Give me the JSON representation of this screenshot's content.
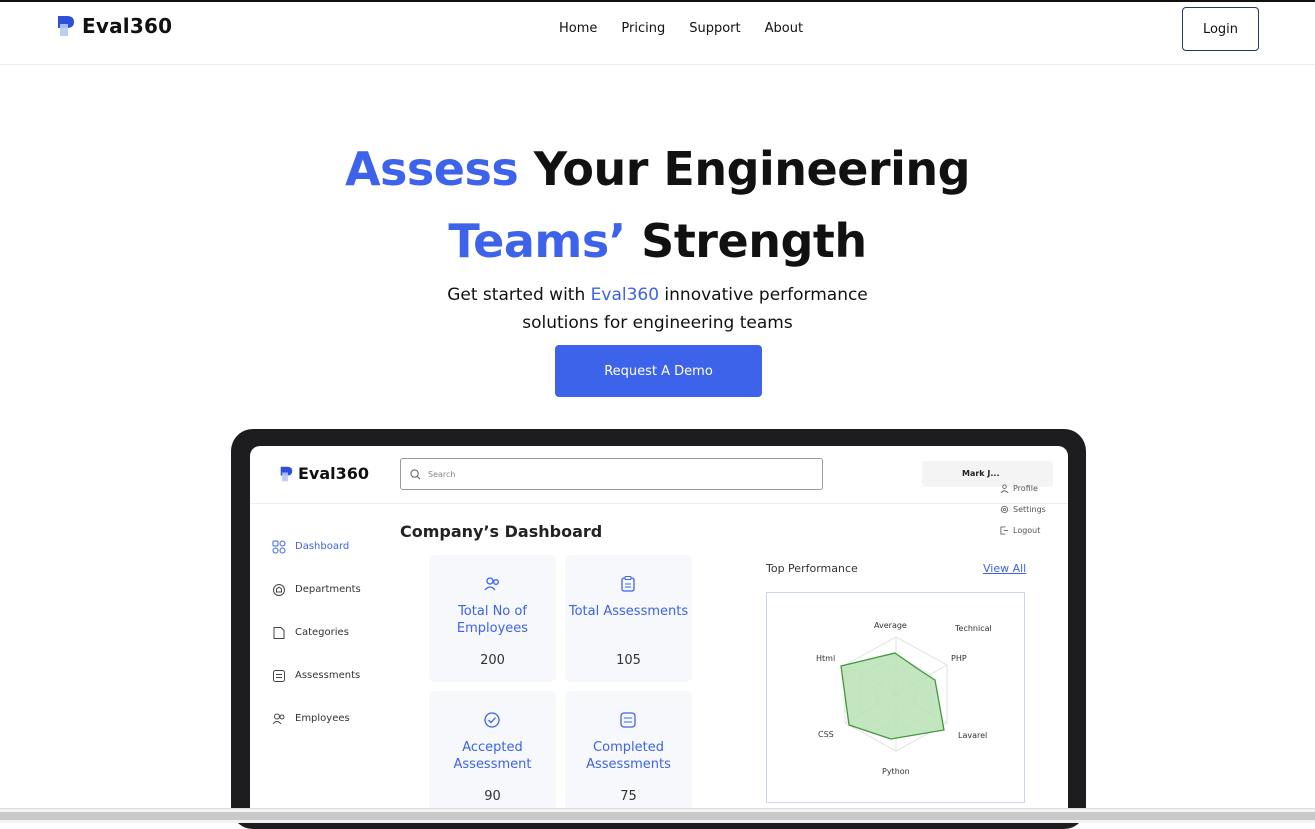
{
  "nav": {
    "brand": "Eval360",
    "links": [
      "Home",
      "Pricing",
      "Support",
      "About"
    ],
    "login": "Login"
  },
  "hero": {
    "line1_hl": "Assess",
    "line1_rest": " Your Engineering",
    "line2_hl": "Teams’",
    "line2_rest": " Strength",
    "sub_pre": "Get started with ",
    "sub_hl": "Eval360",
    "sub_post": " innovative performance",
    "sub_line2": "solutions for engineering teams",
    "cta": "Request A Demo"
  },
  "dashboard": {
    "brand": "Eval360",
    "search_placeholder": "Search",
    "user_name": "Mark J...",
    "user_menu": [
      "Profile",
      "Settings",
      "Logout"
    ],
    "sidebar": [
      {
        "label": "Dashboard",
        "icon": "grid-icon",
        "active": true
      },
      {
        "label": "Departments",
        "icon": "building-icon",
        "active": false
      },
      {
        "label": "Categories",
        "icon": "folder-icon",
        "active": false
      },
      {
        "label": "Assessments",
        "icon": "list-icon",
        "active": false
      },
      {
        "label": "Employees",
        "icon": "users-icon",
        "active": false
      }
    ],
    "title": "Company’s Dashboard",
    "stats": [
      {
        "label": "Total No of Employees",
        "value": "200",
        "icon": "users-icon"
      },
      {
        "label": "Total Assessments",
        "value": "105",
        "icon": "clipboard-icon"
      },
      {
        "label": "Accepted Assessment",
        "value": "90",
        "icon": "check-circle-icon"
      },
      {
        "label": "Completed Assessments",
        "value": "75",
        "icon": "list-check-icon"
      }
    ],
    "performance": {
      "title": "Top Performance",
      "view_all": "View All",
      "radar_labels": [
        "Average",
        "Technical",
        "PHP",
        "Lavarel",
        "Python",
        "CSS",
        "Html"
      ],
      "accent": "#3d63ea",
      "radar_fill": "#b9e0b4",
      "radar_stroke": "#3f9a3a"
    }
  }
}
